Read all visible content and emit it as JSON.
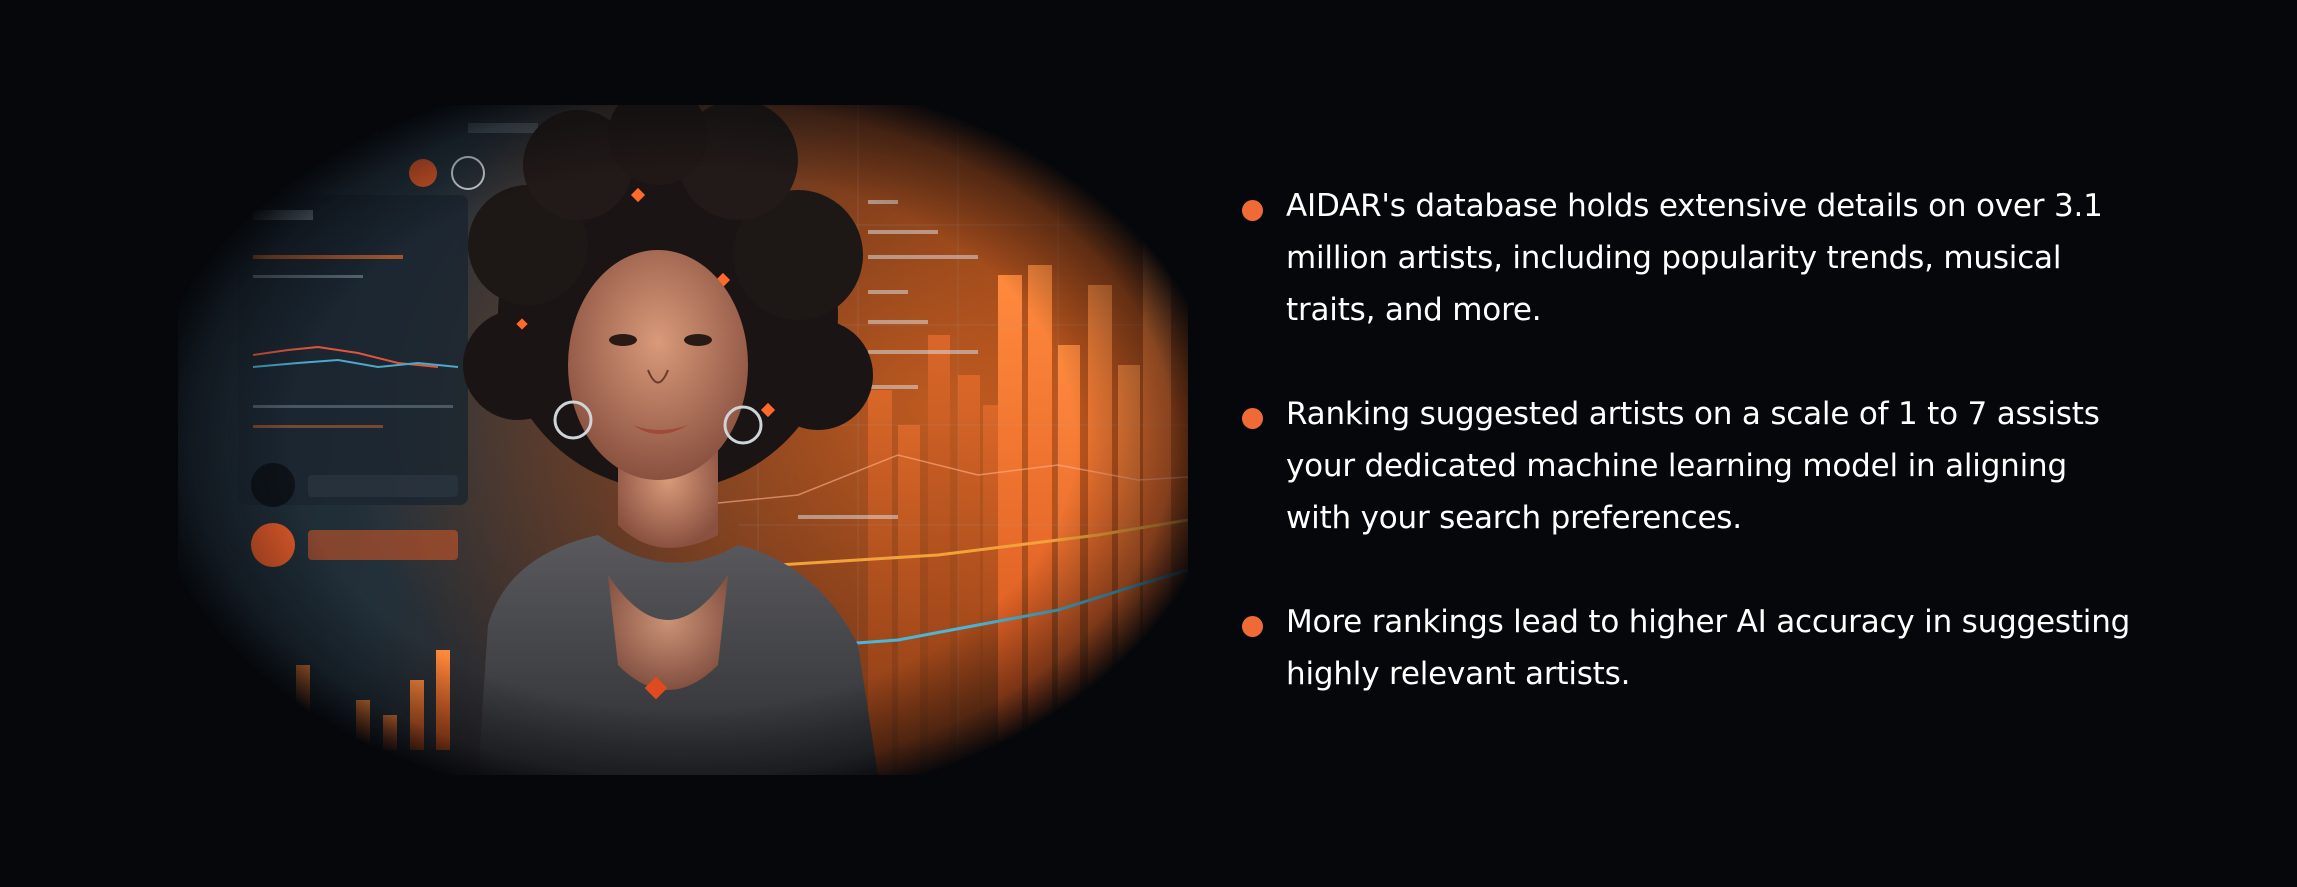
{
  "colors": {
    "background": "#05070b",
    "accent": "#f06a35",
    "text": "#ffffff"
  },
  "hero_image": {
    "icon": "ai-music-analytics-illustration",
    "alt": "Woman in front of music analytics dashboard with orange charts"
  },
  "bullets": [
    {
      "icon": "bullet-dot",
      "text": "AIDAR's database holds extensive details on over 3.1 million artists, including popularity trends, musical traits, and more."
    },
    {
      "icon": "bullet-dot",
      "text": "Ranking suggested artists on a scale of 1 to 7 assists your dedicated machine learning model in aligning with your search preferences."
    },
    {
      "icon": "bullet-dot",
      "text": "More rankings lead to higher AI accuracy in suggesting highly relevant artists."
    }
  ]
}
